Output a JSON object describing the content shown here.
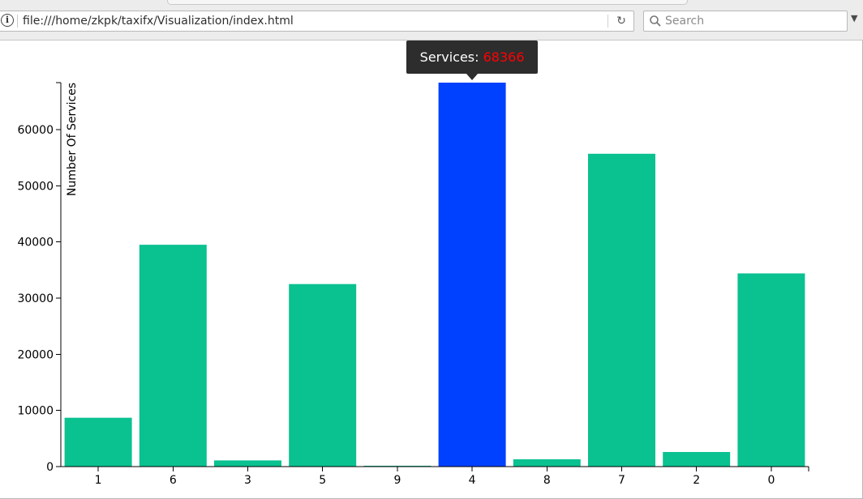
{
  "browser": {
    "url": "file:///home/zkpk/taxifx/Visualization/index.html",
    "search_placeholder": "Search",
    "info_icon": "i",
    "reload_icon": "reload-icon",
    "menu_arrow_icon": "scroll-down-arrow-icon"
  },
  "tooltip": {
    "label": "Services:",
    "value": "68366",
    "category": "4"
  },
  "colors": {
    "bar": "#0ac190",
    "bar_highlight": "#0040ff",
    "tooltip_bg": "#2d2d2d",
    "tooltip_value": "#ff0000"
  },
  "chart_data": {
    "type": "bar",
    "categories": [
      "1",
      "6",
      "3",
      "5",
      "9",
      "4",
      "8",
      "7",
      "2",
      "0"
    ],
    "values": [
      8700,
      39500,
      1100,
      32500,
      150,
      68366,
      1300,
      55700,
      2600,
      34400
    ],
    "highlighted_category": "4",
    "xlabel": "",
    "ylabel": "Number Of Services",
    "ylim": [
      0,
      68366
    ],
    "yticks": [
      0,
      10000,
      20000,
      30000,
      40000,
      50000,
      60000
    ],
    "grid": false
  }
}
